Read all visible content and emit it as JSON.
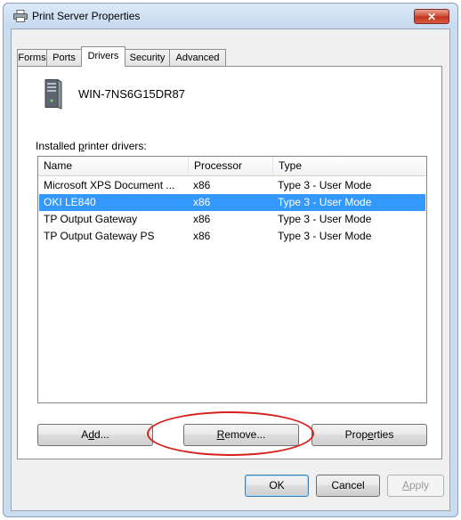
{
  "window": {
    "title": "Print Server Properties",
    "close_label": "✕"
  },
  "tabs": [
    {
      "label": "Forms",
      "active": false
    },
    {
      "label": "Ports",
      "active": false
    },
    {
      "label": "Drivers",
      "active": true
    },
    {
      "label": "Security",
      "active": false
    },
    {
      "label": "Advanced",
      "active": false
    }
  ],
  "server": {
    "name": "WIN-7NS6G15DR87",
    "icon": "server-tower-icon"
  },
  "drivers": {
    "caption_prefix": "Installed ",
    "caption_hotkey": "p",
    "caption_suffix": "rinter drivers:",
    "columns": [
      "Name",
      "Processor",
      "Type"
    ],
    "rows": [
      {
        "name": "Microsoft XPS Document ...",
        "processor": "x86",
        "type": "Type 3 - User Mode",
        "selected": false
      },
      {
        "name": "OKI LE840",
        "processor": "x86",
        "type": "Type 3 - User Mode",
        "selected": true
      },
      {
        "name": "TP Output Gateway",
        "processor": "x86",
        "type": "Type 3 - User Mode",
        "selected": false
      },
      {
        "name": "TP Output Gateway PS",
        "processor": "x86",
        "type": "Type 3 - User Mode",
        "selected": false
      }
    ]
  },
  "actions": {
    "add": {
      "pre": "A",
      "hotkey": "d",
      "post": "d..."
    },
    "remove": {
      "pre": "",
      "hotkey": "R",
      "post": "emove..."
    },
    "properties": {
      "pre": "Prop",
      "hotkey": "e",
      "post": "rties"
    }
  },
  "footer": {
    "ok": "OK",
    "cancel": "Cancel",
    "apply_hotkey": "A",
    "apply_rest": "pply"
  },
  "colors": {
    "selection": "#3399ff",
    "highlight_ring": "#d7201c"
  }
}
